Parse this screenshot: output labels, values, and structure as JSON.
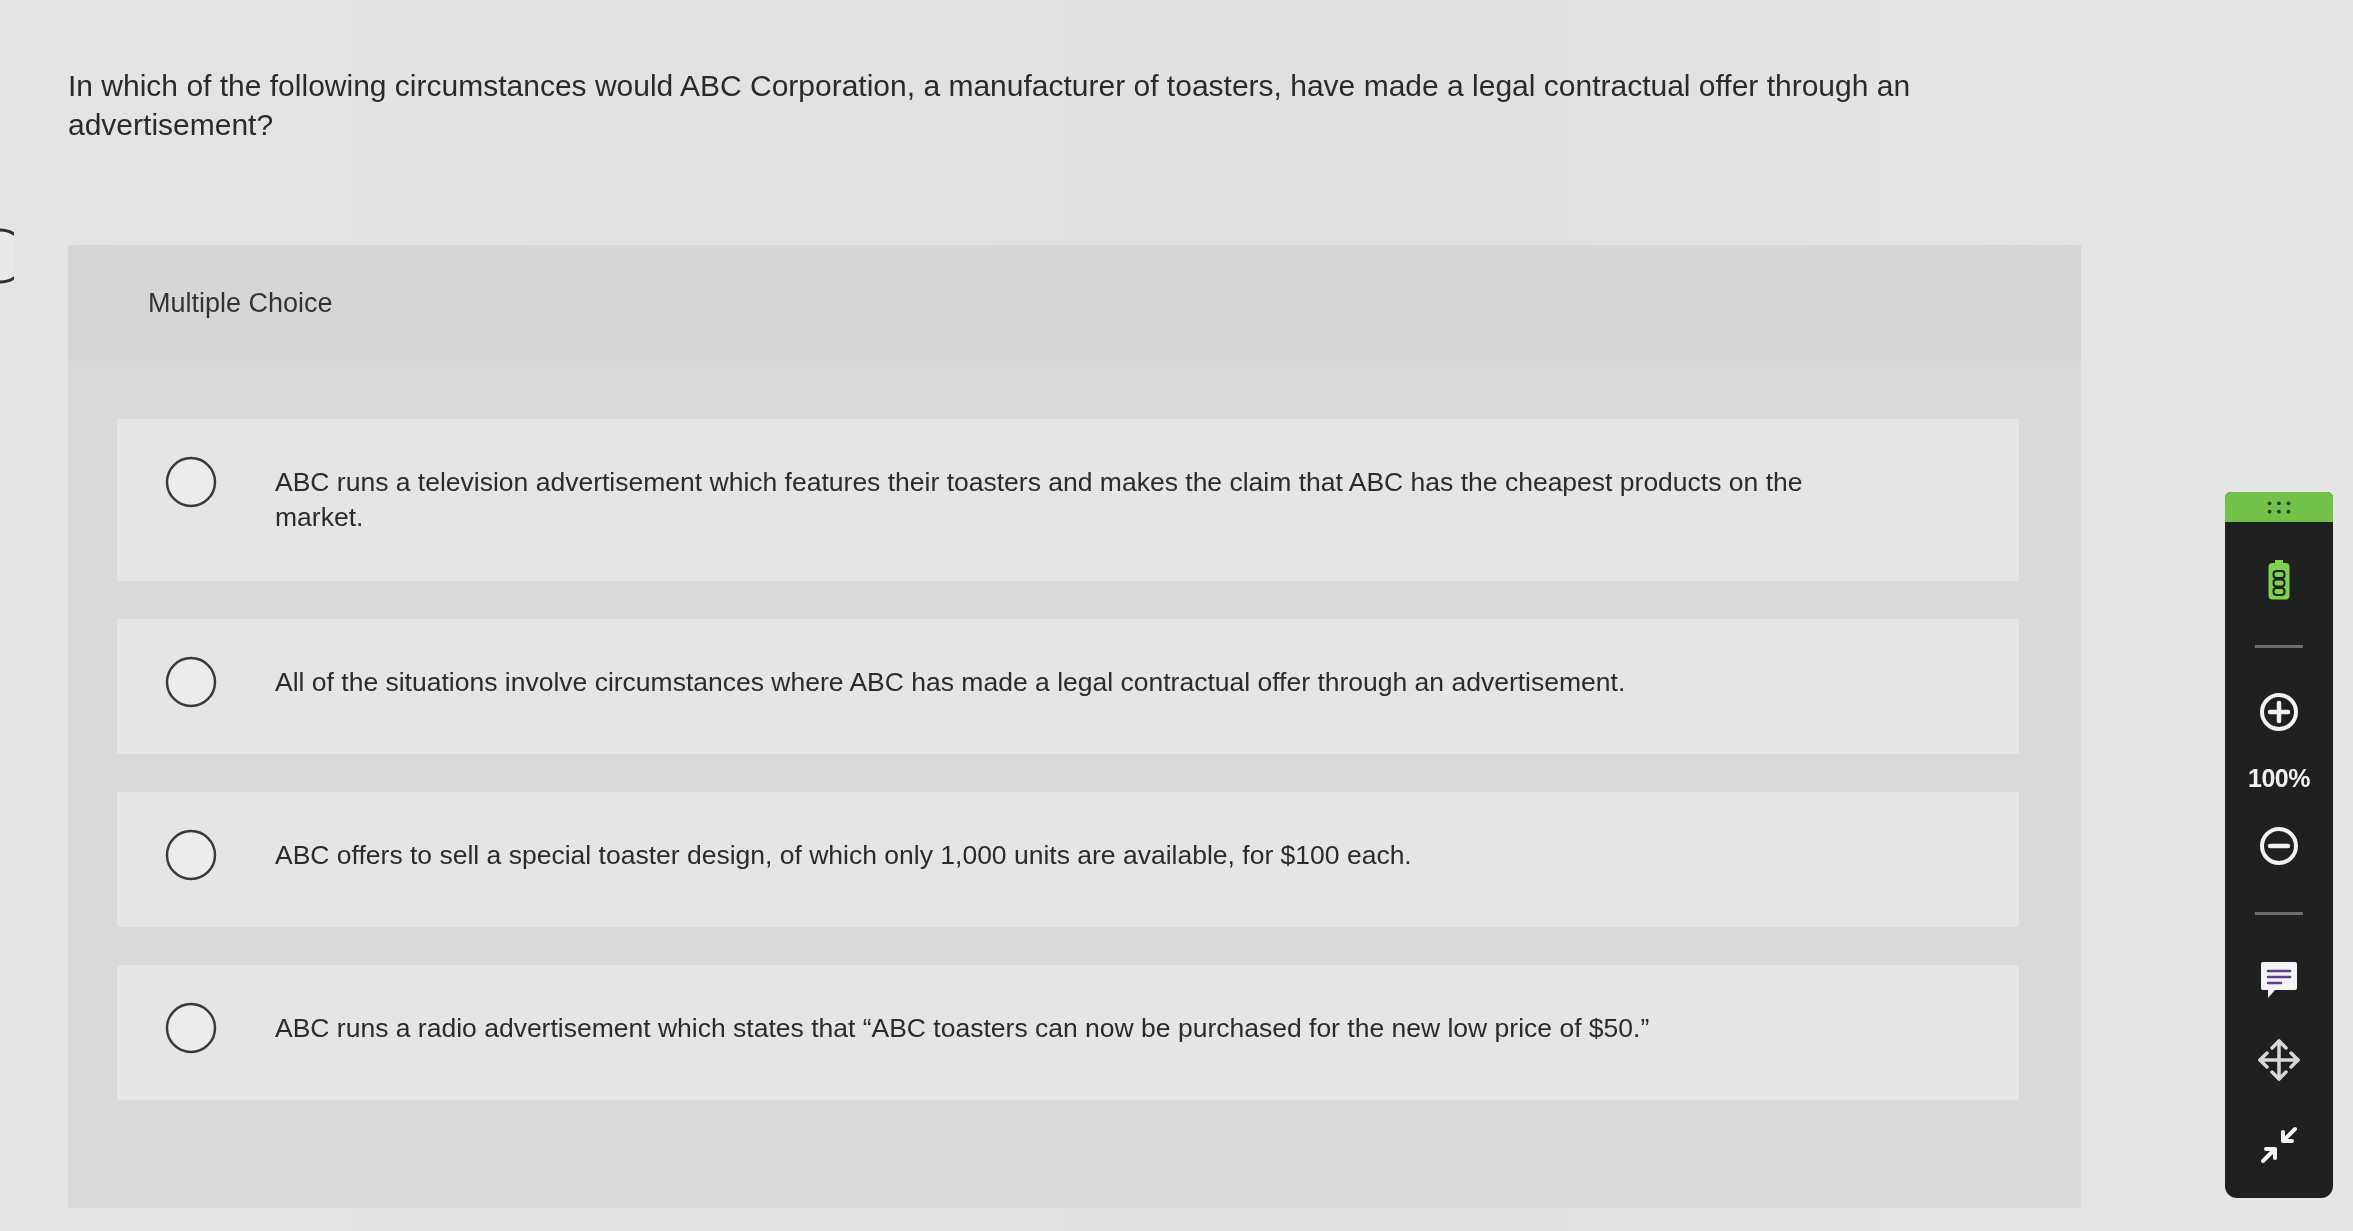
{
  "question": {
    "text": "In which of the following circumstances would ABC Corporation, a manufacturer of toasters, have made a legal contractual offer through an advertisement?"
  },
  "multiple_choice": {
    "label": "Multiple Choice",
    "options": [
      {
        "text": "ABC runs a television advertisement which features their toasters and makes the claim that ABC has the cheapest products on the market.",
        "selected": false
      },
      {
        "text": "All of the situations involve circumstances where ABC has made a legal contractual offer through an advertisement.",
        "selected": false
      },
      {
        "text": "ABC offers to sell a special toaster design, of which only 1,000 units are available, for $100 each.",
        "selected": false
      },
      {
        "text": "ABC runs a radio advertisement which states that “ABC toasters can now be purchased for the new low price of $50.”",
        "selected": false
      }
    ]
  },
  "zoom_toolbar": {
    "zoom_level": "100%"
  }
}
